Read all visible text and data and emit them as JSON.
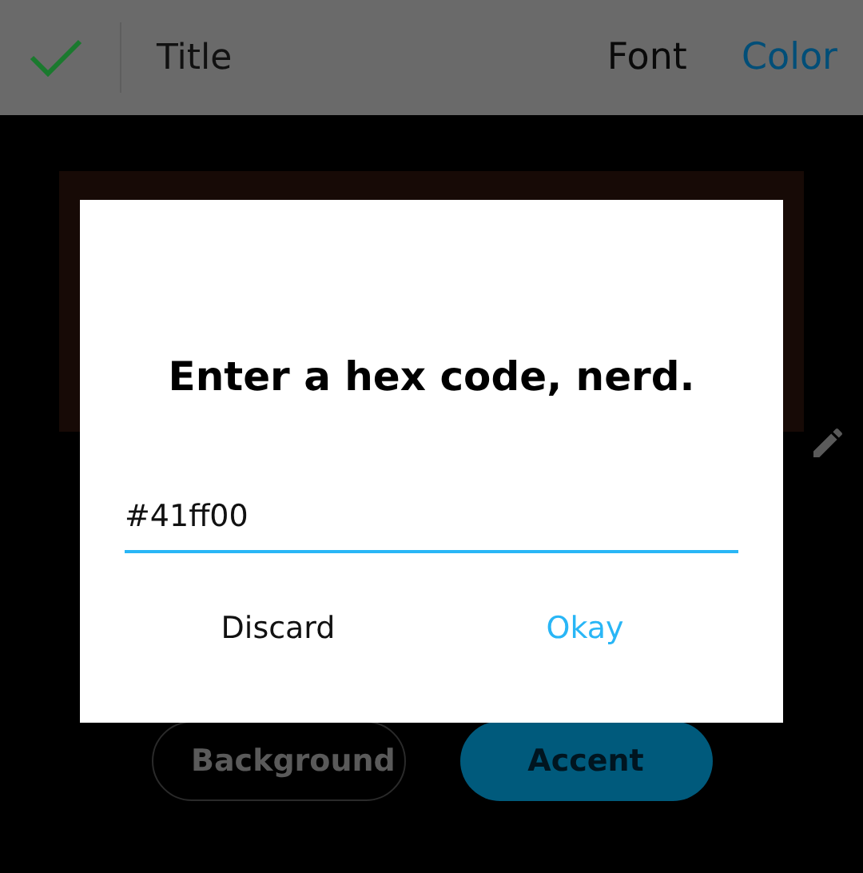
{
  "toolbar": {
    "title": "Title",
    "tabs": [
      {
        "label": "Font",
        "selected": false
      },
      {
        "label": "Color",
        "selected": true
      }
    ]
  },
  "color_targets": [
    {
      "label": "Background",
      "selected": false
    },
    {
      "label": "Accent",
      "selected": true
    }
  ],
  "dialog": {
    "title": "Enter a hex code, nerd.",
    "field": {
      "value": "#41ff00"
    },
    "actions": [
      {
        "label": "Discard",
        "kind": "neutral"
      },
      {
        "label": "Okay",
        "kind": "primary"
      }
    ]
  }
}
